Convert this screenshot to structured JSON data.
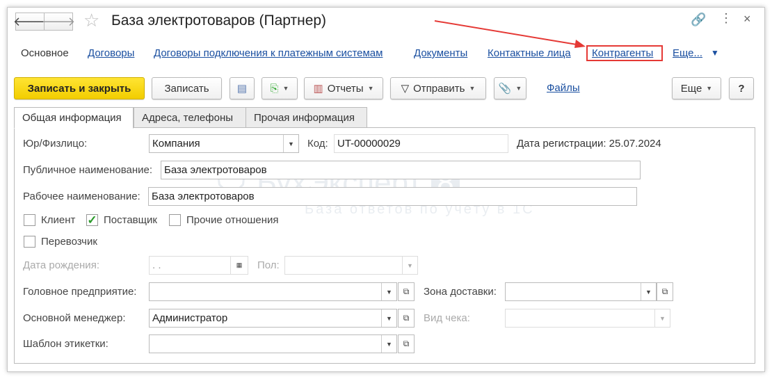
{
  "window": {
    "title": "База электротоваров (Партнер)"
  },
  "nav": {
    "items": [
      "Основное",
      "Договоры",
      "Договоры подключения к платежным системам",
      "Документы",
      "Контактные лица",
      "Контрагенты",
      "Еще..."
    ]
  },
  "toolbar": {
    "save_close": "Записать и закрыть",
    "save": "Записать",
    "reports": "Отчеты",
    "send": "Отправить",
    "files": "Файлы",
    "more": "Еще",
    "help": "?"
  },
  "tabs": [
    "Общая информация",
    "Адреса, телефоны",
    "Прочая информация"
  ],
  "form": {
    "entity_type_label": "Юр/Физлицо:",
    "entity_type_value": "Компания",
    "code_label": "Код:",
    "code_value": "UT-00000029",
    "reg_date_label": "Дата регистрации:",
    "reg_date_value": "25.07.2024",
    "public_name_label": "Публичное наименование:",
    "public_name_value": "База электротоваров",
    "work_name_label": "Рабочее наименование:",
    "work_name_value": "База электротоваров",
    "client_label": "Клиент",
    "supplier_label": "Поставщик",
    "other_label": "Прочие отношения",
    "carrier_label": "Перевозчик",
    "birth_label": "Дата рождения:",
    "birth_value": " .  .",
    "gender_label": "Пол:",
    "parent_label": "Головное предприятие:",
    "delivery_zone_label": "Зона доставки:",
    "manager_label": "Основной менеджер:",
    "manager_value": "Администратор",
    "receipt_label": "Вид чека:",
    "label_template_label": "Шаблон этикетки:",
    "supplier_checked": true,
    "client_checked": false,
    "other_checked": false,
    "carrier_checked": false
  },
  "watermark": {
    "brand": "БухЭксперт",
    "badge": "8",
    "tagline": "База ответов по учёту в 1С"
  },
  "colors": {
    "primary": "#f5d000",
    "link": "#1a4fa0",
    "highlight": "#e53935"
  }
}
